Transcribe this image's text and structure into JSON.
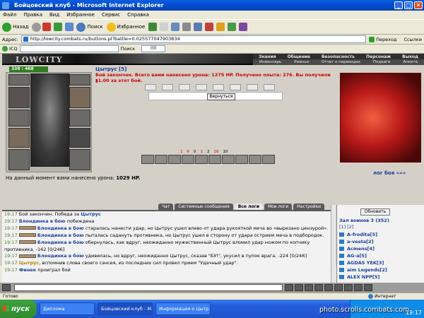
{
  "window": {
    "title": "Бойцовский клуб - Microsoft Internet Explorer"
  },
  "menu": [
    "Файл",
    "Правка",
    "Вид",
    "Избранное",
    "Сервис",
    "Справка"
  ],
  "toolbar": {
    "back": "Назад",
    "search": "Поиск",
    "favorites": "Избранное"
  },
  "address": {
    "label": "Адрес:",
    "url": "http://lowcity.combats.ru/buttons.pl?battle=0.025577047903834",
    "go": "Переход",
    "links": "Ссылки"
  },
  "icqbar": {
    "icq": "ICQ",
    "search": "Поиск",
    "counter": "(0)"
  },
  "game": {
    "logo": "LOWCITY",
    "nav_top": [
      "Знания",
      "Общение",
      "Безопасность",
      "Персонаж",
      "Выход"
    ],
    "nav_bottom": [
      "Инвентарь",
      "Уменья",
      "Отчет о переводах",
      "Подвиги",
      "Анкета"
    ],
    "hp": "338 : 468",
    "player": "Цытрус [5]",
    "battle_message": "Бой закончен. Всего вами нанесено урона: 1275 HP. Получено опыта: 276. Вы получили ▮1.00 за этот бой.",
    "return_button": "Вернуться",
    "stats": [
      "1",
      "6",
      "0",
      "1",
      "2",
      "16",
      "10"
    ],
    "battle_log_link": "лог боя »»»",
    "damage_text": "На данный момент вами нанесено урона:",
    "damage_value": "1029 HP."
  },
  "tabs": [
    {
      "label": "Чат",
      "active": false
    },
    {
      "label": "Системные сообщения",
      "active": false
    },
    {
      "label": "Все логи",
      "active": true
    },
    {
      "label": "Мои логи",
      "active": false
    },
    {
      "label": "Настройки",
      "active": false
    }
  ],
  "chat_lines": [
    {
      "time": "19:17",
      "text": "Бой закончен. Победа за ",
      "who": "Цытрус",
      "rest": ""
    },
    {
      "time": "19:17",
      "text": "",
      "who": "Блондинка в бою",
      "rest": " побеждена"
    },
    {
      "time": "19:17",
      "text": "",
      "who": "Блондинка в бою",
      "rest": " старалась нанести удар, но Цытрус ушел влево от удара рукояткой меча во «вырезано цензурой»."
    },
    {
      "time": "19:17",
      "text": "",
      "who": "Блондинка в бою",
      "rest": " пыталась садануть противника, но Цытрус ушел в сторону от удара острием меча в подбородок."
    },
    {
      "time": "19:17",
      "text": "",
      "who": "Блондинка в бою",
      "rest": " обернулась, как вдруг, неожиданно мужественный Цытрус вломил удар ножом по копчику противника. -162 [0/246]"
    },
    {
      "time": "19:17",
      "text": "",
      "who": "Блондинка в бою",
      "rest": " удивилась, но вдруг, неожиданно Цытрус, сказав \"БУ!\", укусил в пупок врага. -224 [0/246]"
    },
    {
      "time": "19:17",
      "text": "",
      "who": "Цытрус",
      "rest": ", вспомнив слова своего сэнсея, из последних сил провел прием \"Удачный удар\"."
    },
    {
      "time": "19:17",
      "text": "",
      "who": "Финек",
      "rest": " проиграл бой"
    }
  ],
  "right_panel": {
    "refresh": "Обновить",
    "room": "Зал воинов 3 (352)",
    "pages": "[1] [2]",
    "users": [
      "A-frodita[5]",
      "a-vesta[2]",
      "Acmens[4]",
      "AG-a[5]",
      "AGDAS YEK[3]",
      "aim Legends[2]",
      "ALEX NPP[5]"
    ]
  },
  "statusbar": {
    "left": "Готово",
    "right": "Интернет"
  },
  "taskbar": {
    "start": "пуск",
    "tasks": [
      "Диплома",
      "Бойцовский клуб - M...",
      "Информация о Цытр..."
    ],
    "watermark": "photo.scrolls.combats.com",
    "clock": "19:17"
  }
}
